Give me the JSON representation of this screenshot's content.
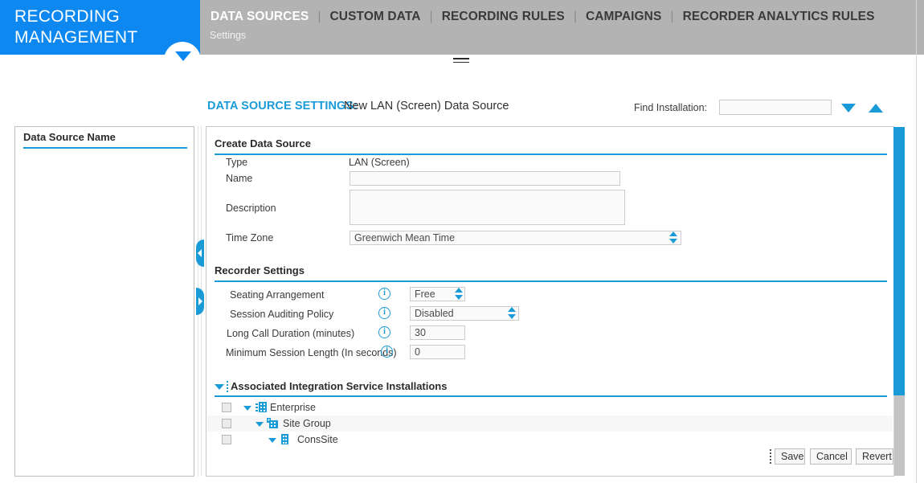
{
  "brand": {
    "line1": "RECORDING",
    "line2": "MANAGEMENT"
  },
  "nav": {
    "items": [
      {
        "label": "DATA SOURCES",
        "active": true
      },
      {
        "label": "CUSTOM DATA",
        "active": false
      },
      {
        "label": "RECORDING RULES",
        "active": false
      },
      {
        "label": "CAMPAIGNS",
        "active": false
      },
      {
        "label": "RECORDER ANALYTICS RULES",
        "active": false
      }
    ],
    "subtitle": "Settings"
  },
  "title_row": {
    "settings_label": "DATA SOURCE SETTINGS:",
    "settings_value": "New LAN (Screen) Data Source",
    "find_label": "Find Installation:",
    "find_value": "",
    "find_placeholder": ""
  },
  "left_panel": {
    "header": "Data Source Name",
    "items": []
  },
  "create_section": {
    "title": "Create Data Source",
    "type_label": "Type",
    "type_value": "LAN (Screen)",
    "name_label": "Name",
    "name_value": "",
    "description_label": "Description",
    "description_value": "",
    "timezone_label": "Time Zone",
    "timezone_value": "Greenwich Mean Time"
  },
  "recorder_section": {
    "title": "Recorder Settings",
    "rows": [
      {
        "label": "Seating Arrangement",
        "value": "Free"
      },
      {
        "label": "Session Auditing Policy",
        "value": "Disabled"
      },
      {
        "label": "Long Call Duration (minutes)",
        "value": "30"
      },
      {
        "label": "Minimum Session Length (In seconds)",
        "value": "0"
      }
    ]
  },
  "tree": {
    "title": "Associated Integration Service Installations",
    "nodes": [
      {
        "label": "Enterprise",
        "checked": false
      },
      {
        "label": "Site Group",
        "checked": false
      },
      {
        "label": "ConsSite",
        "checked": false
      }
    ]
  },
  "buttons": {
    "save": "Save",
    "cancel": "Cancel",
    "revert": "Revert"
  },
  "colors": {
    "brand_blue": "#0d88f0",
    "accent": "#1a9bd7",
    "nav_gray": "#b3b3b3"
  }
}
